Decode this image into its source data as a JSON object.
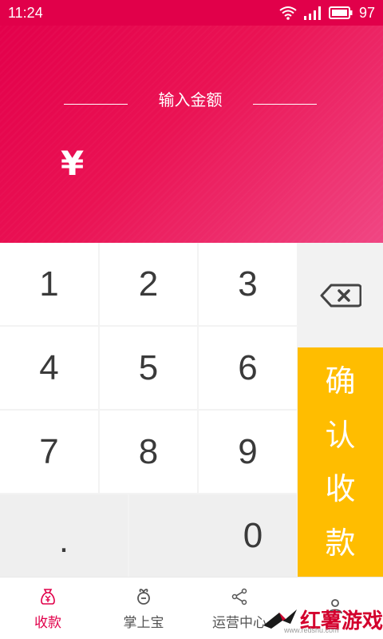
{
  "status_bar": {
    "time": "11:24",
    "battery_level": "97"
  },
  "header": {
    "title": "输入金额",
    "currency_symbol": "¥"
  },
  "keypad": {
    "keys": [
      "1",
      "2",
      "3",
      "4",
      "5",
      "6",
      "7",
      "8",
      "9"
    ],
    "dot": ".",
    "zero": "0",
    "confirm_chars": [
      "确",
      "认",
      "收",
      "款"
    ]
  },
  "tabs": [
    {
      "label": "收款",
      "icon": "money-bag-icon",
      "active": true
    },
    {
      "label": "掌上宝",
      "icon": "gift-icon",
      "active": false
    },
    {
      "label": "运营中心",
      "icon": "share-icon",
      "active": false
    },
    {
      "label": "",
      "icon": "user-icon",
      "active": false
    }
  ],
  "watermark": {
    "text": "红薯游戏",
    "url": "www.redshu.com"
  },
  "colors": {
    "primary": "#e1004a",
    "confirm": "#ffbd00"
  }
}
